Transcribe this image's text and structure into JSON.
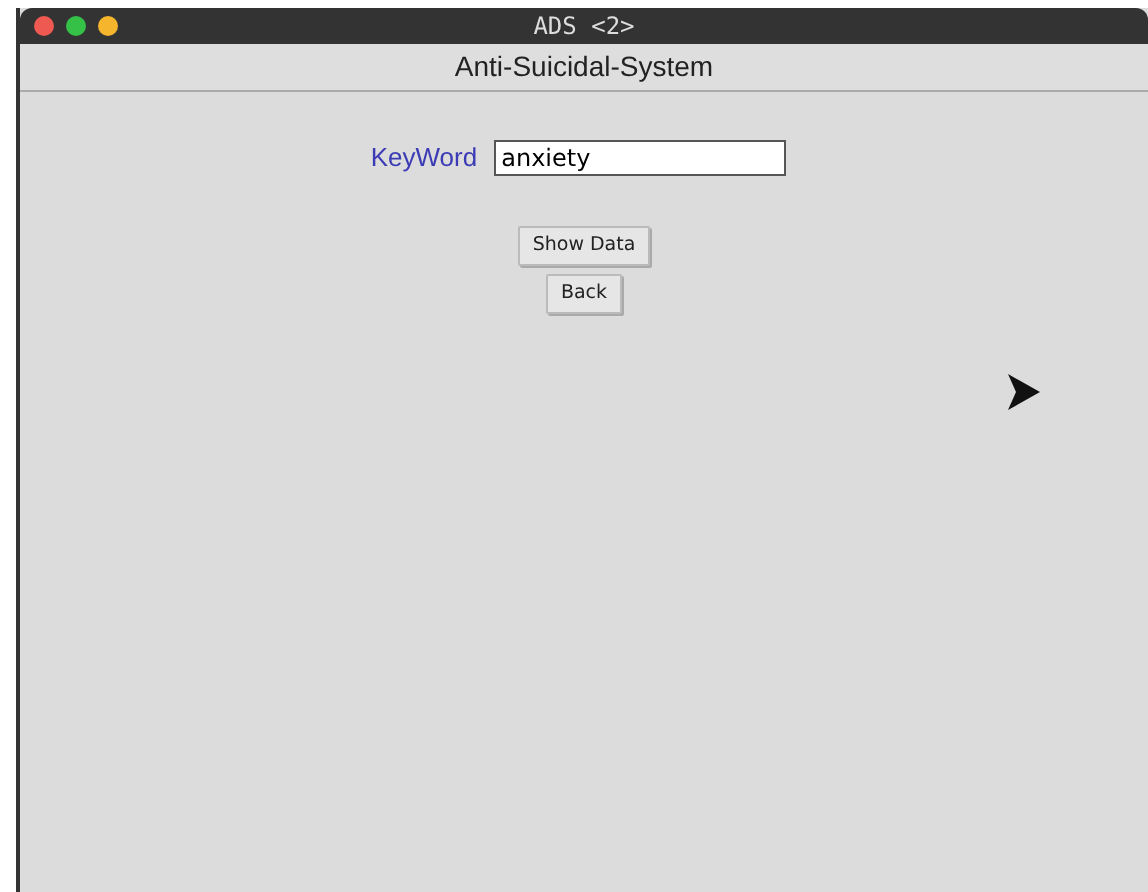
{
  "window": {
    "title": "ADS <2>"
  },
  "header": {
    "title": "Anti-Suicidal-System"
  },
  "form": {
    "label": "KeyWord",
    "value": "anxiety"
  },
  "buttons": [
    "Show Data",
    "Back"
  ]
}
